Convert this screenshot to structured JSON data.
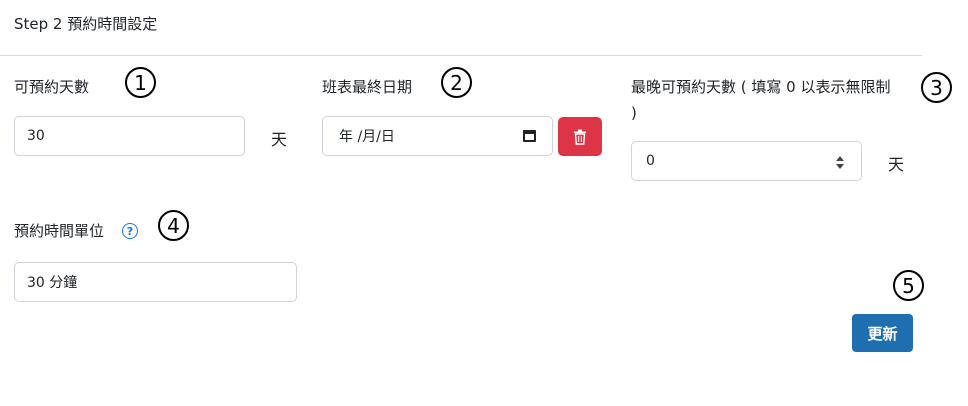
{
  "step_title": "Step 2 預約時間設定",
  "fields": {
    "bookable_days": {
      "label": "可預約天數",
      "value": "30",
      "unit": "天",
      "marker": "1"
    },
    "shift_end_date": {
      "label": "班表最終日期",
      "placeholder": "年 /月/日",
      "marker": "2"
    },
    "latest_bookable_days": {
      "label": "最晚可預約天數 ( 填寫 0 以表示無限制",
      "label_tail": ")",
      "value": "0",
      "unit": "天",
      "marker": "3"
    },
    "time_unit": {
      "label": "預約時間單位",
      "value": "30 分鐘",
      "marker": "4",
      "help_glyph": "?"
    }
  },
  "update": {
    "label": "更新",
    "marker": "5"
  },
  "icons": {
    "calendar": "calendar-icon",
    "trash": "trash-icon",
    "help": "help-icon",
    "spinner": "spinner-icon"
  },
  "colors": {
    "danger": "#dc3545",
    "primary": "#1f6fb0",
    "help": "#1a73e8"
  }
}
